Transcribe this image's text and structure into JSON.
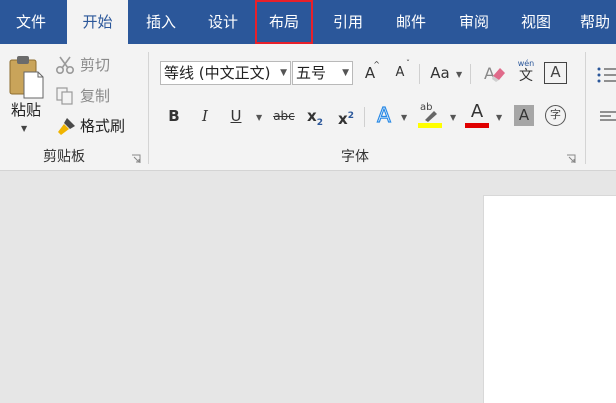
{
  "tabs": [
    {
      "label": "文件"
    },
    {
      "label": "开始"
    },
    {
      "label": "插入"
    },
    {
      "label": "设计"
    },
    {
      "label": "布局"
    },
    {
      "label": "引用"
    },
    {
      "label": "邮件"
    },
    {
      "label": "审阅"
    },
    {
      "label": "视图"
    },
    {
      "label": "帮助"
    }
  ],
  "clipboard": {
    "paste_label": "粘贴",
    "cut_label": "剪切",
    "copy_label": "复制",
    "format_painter_label": "格式刷",
    "group_label": "剪贴板"
  },
  "font": {
    "font_name": "等线 (中文正文)",
    "font_size": "五号",
    "grow_label": "A",
    "shrink_label": "A",
    "case_label": "Aa",
    "bold_label": "B",
    "italic_label": "I",
    "underline_label": "U",
    "strike_label": "abc",
    "sub_label": "x",
    "sub_mark": "2",
    "sup_label": "x",
    "sup_mark": "2",
    "effects_label": "A",
    "highlight_label": "ab",
    "color_label": "A",
    "shading_label": "A",
    "enclose_label": "字",
    "phonetic_top": "wén",
    "phonetic_bottom": "文",
    "border_label": "A",
    "group_label": "字体"
  },
  "colors": {
    "accent": "#2b579a",
    "highlight_box": "#e8202a",
    "highlight_yellow": "#ffff00",
    "font_red": "#e00000"
  }
}
